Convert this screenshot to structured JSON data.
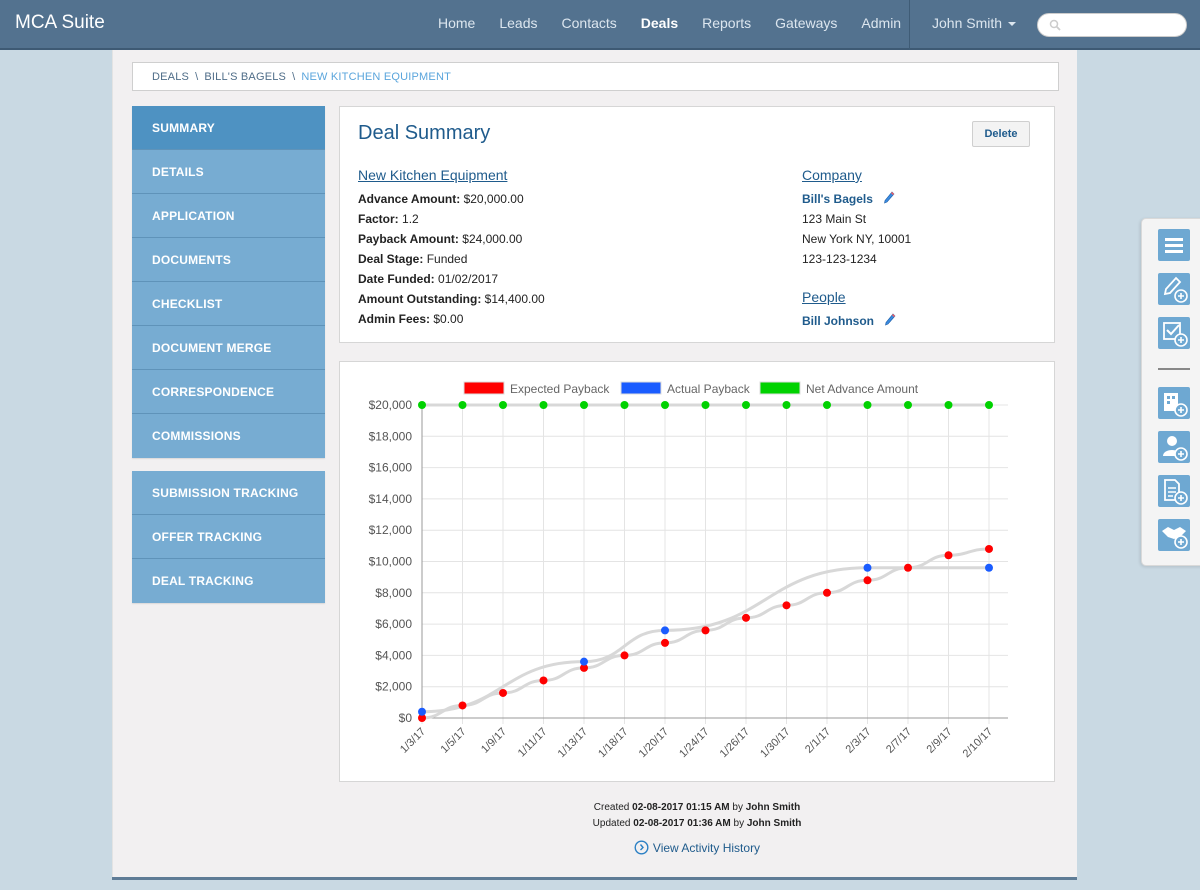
{
  "app": {
    "title": "MCA Suite"
  },
  "nav": {
    "links": [
      {
        "label": "Home",
        "active": false
      },
      {
        "label": "Leads",
        "active": false
      },
      {
        "label": "Contacts",
        "active": false
      },
      {
        "label": "Deals",
        "active": true
      },
      {
        "label": "Reports",
        "active": false
      },
      {
        "label": "Gateways",
        "active": false
      },
      {
        "label": "Admin",
        "active": false
      }
    ],
    "user": "John Smith",
    "search_placeholder": ""
  },
  "breadcrumb": [
    "DEALS",
    "BILL'S BAGELS",
    "NEW KITCHEN EQUIPMENT"
  ],
  "sidebar": {
    "groups": [
      [
        "SUMMARY",
        "DETAILS",
        "APPLICATION",
        "DOCUMENTS",
        "CHECKLIST",
        "DOCUMENT MERGE",
        "CORRESPONDENCE",
        "COMMISSIONS"
      ],
      [
        "SUBMISSION TRACKING",
        "OFFER TRACKING",
        "DEAL TRACKING"
      ]
    ],
    "active": "SUMMARY"
  },
  "summary": {
    "title": "Deal Summary",
    "delete_label": "Delete",
    "deal_name": "New Kitchen Equipment",
    "fields": [
      {
        "label": "Advance Amount:",
        "value": "$20,000.00"
      },
      {
        "label": "Factor:",
        "value": "1.2"
      },
      {
        "label": "Payback Amount:",
        "value": "$24,000.00"
      },
      {
        "label": "Deal Stage:",
        "value": "Funded"
      },
      {
        "label": "Date Funded:",
        "value": "01/02/2017"
      },
      {
        "label": "Amount Outstanding:",
        "value": "$14,400.00"
      },
      {
        "label": "Admin Fees:",
        "value": "$0.00"
      }
    ],
    "company_heading": "Company",
    "company": {
      "name": "Bill's Bagels",
      "address1": "123 Main St",
      "address2": "New York NY, 10001",
      "phone": "123-123-1234"
    },
    "people_heading": "People",
    "people": [
      "Bill Johnson"
    ]
  },
  "chart_data": {
    "type": "line",
    "title": "",
    "xlabel": "",
    "ylabel": "",
    "categories": [
      "1/3/17",
      "1/5/17",
      "1/9/17",
      "1/11/17",
      "1/13/17",
      "1/18/17",
      "1/20/17",
      "1/24/17",
      "1/26/17",
      "1/30/17",
      "2/1/17",
      "2/3/17",
      "2/7/17",
      "2/9/17",
      "2/10/17"
    ],
    "ylim": [
      0,
      20000
    ],
    "yticks": [
      0,
      2000,
      4000,
      6000,
      8000,
      10000,
      12000,
      14000,
      16000,
      18000,
      20000
    ],
    "ytick_labels": [
      "$0",
      "$2,000",
      "$4,000",
      "$6,000",
      "$8,000",
      "$10,000",
      "$12,000",
      "$14,000",
      "$16,000",
      "$18,000",
      "$20,000"
    ],
    "grid": true,
    "legend_position": "top",
    "series": [
      {
        "name": "Expected Payback",
        "color": "#ff0000",
        "values": [
          0,
          800,
          1600,
          2400,
          3200,
          4000,
          4800,
          5600,
          6400,
          7200,
          8000,
          8800,
          9600,
          10400,
          10800
        ]
      },
      {
        "name": "Actual Payback",
        "color": "#1a5cff",
        "values": [
          400,
          null,
          null,
          null,
          3600,
          null,
          5600,
          null,
          null,
          null,
          null,
          9600,
          null,
          null,
          9600
        ]
      },
      {
        "name": "Net Advance Amount",
        "color": "#00d200",
        "values": [
          20000,
          20000,
          20000,
          20000,
          20000,
          20000,
          20000,
          20000,
          20000,
          20000,
          20000,
          20000,
          20000,
          20000,
          20000
        ]
      }
    ]
  },
  "meta": {
    "created_prefix": "Created",
    "created_at": "02-08-2017 01:15 AM",
    "created_by_prefix": "by",
    "created_by": "John Smith",
    "updated_prefix": "Updated",
    "updated_at": "02-08-2017 01:36 AM",
    "updated_by_prefix": "by",
    "updated_by": "John Smith",
    "activity_link": "View Activity History"
  },
  "toolbar": {
    "icons": [
      "menu-icon",
      "add-note-icon",
      "add-task-icon",
      "add-company-icon",
      "add-contact-icon",
      "add-document-icon",
      "add-deal-icon"
    ]
  }
}
